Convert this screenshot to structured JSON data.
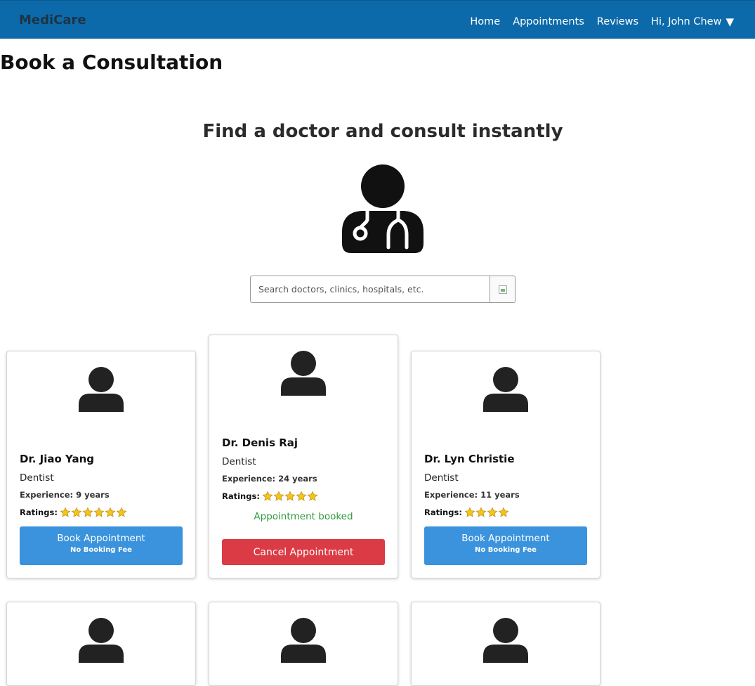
{
  "nav": {
    "brand": "MediCare",
    "links": [
      "Home",
      "Appointments",
      "Reviews"
    ],
    "user_greeting": "Hi, John Chew",
    "caret": "▼"
  },
  "page_title": "Book a Consultation",
  "hero": {
    "title": "Find a doctor and consult instantly",
    "icon": "doctor-icon"
  },
  "search": {
    "placeholder": "Search doctors, clinics, hospitals, etc.",
    "value": ""
  },
  "doctors": [
    {
      "name": "Dr. Jiao Yang",
      "specialty": "Dentist",
      "experience": "Experience: 9 years",
      "ratings_label": "Ratings:",
      "stars": 6,
      "status": "available",
      "book_label": "Book Appointment",
      "fee_note": "No Booking Fee"
    },
    {
      "name": "Dr. Denis Raj",
      "specialty": "Dentist",
      "experience": "Experience: 24 years",
      "ratings_label": "Ratings:",
      "stars": 5,
      "status": "booked",
      "booked_label": "Appointment booked",
      "cancel_label": "Cancel Appointment"
    },
    {
      "name": "Dr. Lyn Christie",
      "specialty": "Dentist",
      "experience": "Experience: 11 years",
      "ratings_label": "Ratings:",
      "stars": 4,
      "status": "available",
      "book_label": "Book Appointment",
      "fee_note": "No Booking Fee"
    }
  ],
  "colors": {
    "navbar": "#0d6aaa",
    "book_button": "#3a93dc",
    "cancel_button": "#db3b45",
    "booked_text": "#2e9a3a",
    "star": "#f5c518"
  }
}
